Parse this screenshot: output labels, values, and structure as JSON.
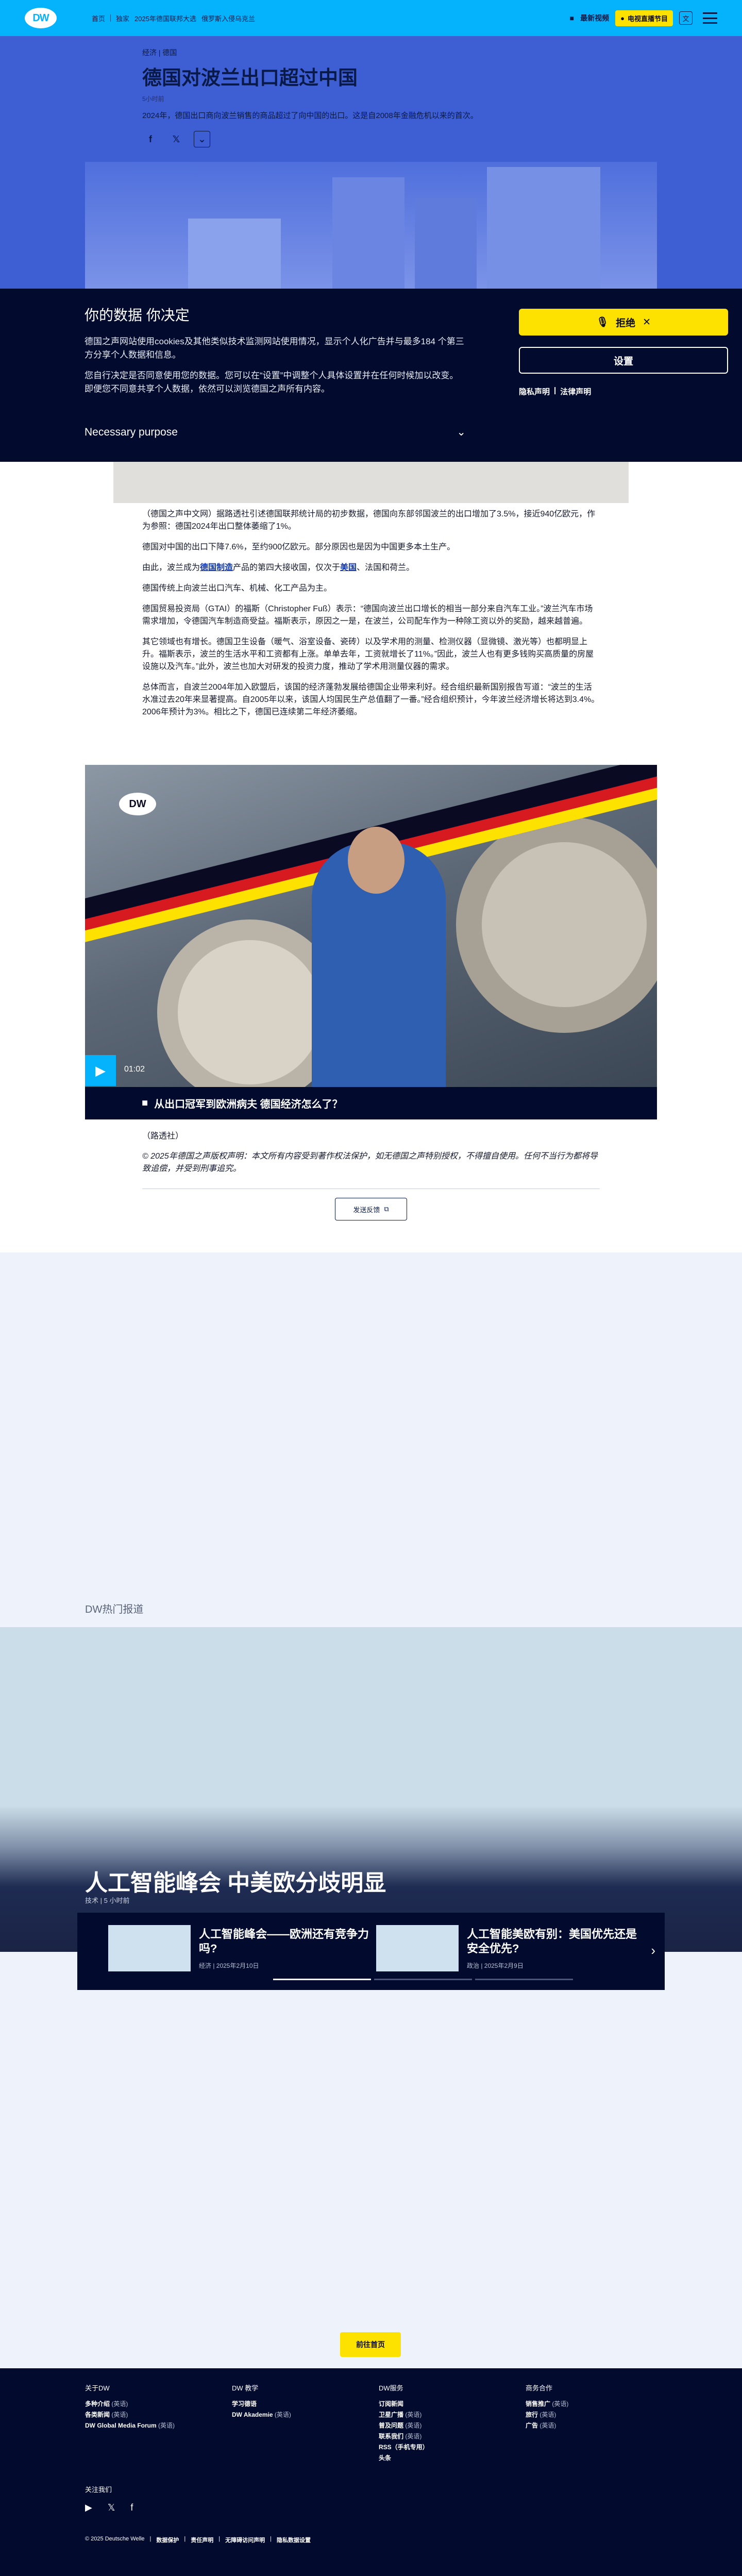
{
  "header": {
    "logo": "DW",
    "nav": [
      "首页",
      "独家",
      "2025年德国联邦大选",
      "俄罗斯入侵乌克兰"
    ],
    "latest": "最新视频",
    "live": "电视直播节目",
    "lang": "文"
  },
  "hero": {
    "breadcrumb": "经济 | 德国",
    "title": "德国对波兰出口超过中国",
    "date": "5小时前",
    "lead": "2024年，德国出口商向波兰销售的商品超过了向中国的出口。这是自2008年金融危机以来的首次。"
  },
  "cookie": {
    "title": "你的数据 你决定",
    "p1": "德国之声网站使用cookies及其他类似技术监测网站使用情况，显示个人化广告并与最多184 个第三方分享个人数据和信息。",
    "p2": "您自行决定是否同意使用您的数据。您可以在“设置”中调整个人具体设置并在任何时候加以改变。即便您不同意共享个人数据，依然可以浏览德国之声所有内容。",
    "purpose": "Necessary purpose",
    "reject": "拒绝",
    "settings": "设置",
    "privacy": "隐私声明",
    "legal": "法律声明"
  },
  "article": {
    "p1": "（德国之声中文网）据路透社引述德国联邦统计局的初步数据，德国向东部邻国波兰的出口增加了3.5%，接近940亿欧元，作为参照：德国2024年出口整体萎缩了1%。",
    "p2": "德国对中国的出口下降7.6%，至约900亿欧元。部分原因也是因为中国更多本土生产。",
    "p3a": "由此，波兰成为",
    "p3link1": "德国制造",
    "p3b": "产品的第四大接收国，仅次于",
    "p3link2": "美国",
    "p3c": "、法国和荷兰。",
    "p4": "德国传统上向波兰出口汽车、机械、化工产品为主。",
    "p5": "德国贸易投资局（GTAI）的福斯（Christopher Fuß）表示：“德国向波兰出口增长的相当一部分来自汽车工业。”波兰汽车市场需求增加，令德国汽车制造商受益。福斯表示，原因之一是，在波兰，公司配车作为一种除工资以外的奖励，越来越普遍。",
    "p6": "其它领域也有增长。德国卫生设备（暖气、浴室设备、瓷砖）以及学术用的测量、检测仪器（显微镜、激光等）也都明显上升。福斯表示，波兰的生活水平和工资都有上涨。单单去年，工资就增长了11%。”因此，波兰人也有更多钱购买高质量的房屋设施以及汽车。”此外，波兰也加大对研发的投资力度，推动了学术用测量仪器的需求。",
    "p7": "总体而言，自波兰2004年加入欧盟后，该国的经济蓬勃发展给德国企业带来利好。经合组织最新国别报告写道：“波兰的生活水准过去20年来显著提高。自2005年以来，该国人均国民生产总值翻了一番。”经合组织预计，今年波兰经济增长将达到3.4%。2006年预计为3%。相比之下，德国已连续第二年经济萎缩。"
  },
  "video": {
    "logo": "DW",
    "time": "01:02",
    "caption": "从出口冠军到欧洲病夫 德国经济怎么了？"
  },
  "credit": "（路透社）",
  "copyright": "© 2025年德国之声版权声明：本文所有内容受到著作权法保护，如无德国之声特别授权，不得擅自使用。任何不当行为都将导致追偿，并受到刑事追究。",
  "feedback": "发送反馈",
  "hot": {
    "label": "DW热门报道",
    "topic": "人工智能峰会 中美欧分歧明显",
    "topic_meta": "技术 | 5 小时前",
    "cards": [
      {
        "title": "人工智能峰会——欧洲还有竞争力吗?",
        "meta": "经济 | 2025年2月10日"
      },
      {
        "title": "人工智能美欧有别：美国优先还是安全优先?",
        "meta": "政治 | 2025年2月9日"
      }
    ]
  },
  "home_button": "前往首页",
  "footer": {
    "cols": [
      {
        "title": "关于DW",
        "items": [
          [
            "多种介绍",
            "(英语)"
          ],
          [
            "各类新闻",
            "(英语)"
          ],
          [
            "DW Global Media Forum",
            "(英语)"
          ]
        ]
      },
      {
        "title": "DW 教学",
        "items": [
          [
            "学习德语",
            ""
          ],
          [
            "DW Akademie",
            "(英语)"
          ]
        ]
      },
      {
        "title": "DW服务",
        "items": [
          [
            "订阅新闻",
            ""
          ],
          [
            "卫星广播",
            "(英语)"
          ],
          [
            "普及问题",
            "(英语)"
          ],
          [
            "联系我们",
            "(英语)"
          ],
          [
            "RSS（手机专用）",
            ""
          ],
          [
            "头条",
            ""
          ]
        ]
      },
      {
        "title": "商务合作",
        "items": [
          [
            "销售推广",
            "(英语)"
          ],
          [
            "旅行",
            "(英语)"
          ],
          [
            "广告",
            "(英语)"
          ]
        ]
      }
    ],
    "follow": "关注我们",
    "bottom": [
      "© 2025 Deutsche Welle",
      "数据保护",
      "责任声明",
      "无障碍访问声明",
      "隐私数据设置"
    ]
  },
  "colors": {
    "accent": "#05b2fc",
    "yellow": "#fde200",
    "navy": "#020a2d"
  }
}
